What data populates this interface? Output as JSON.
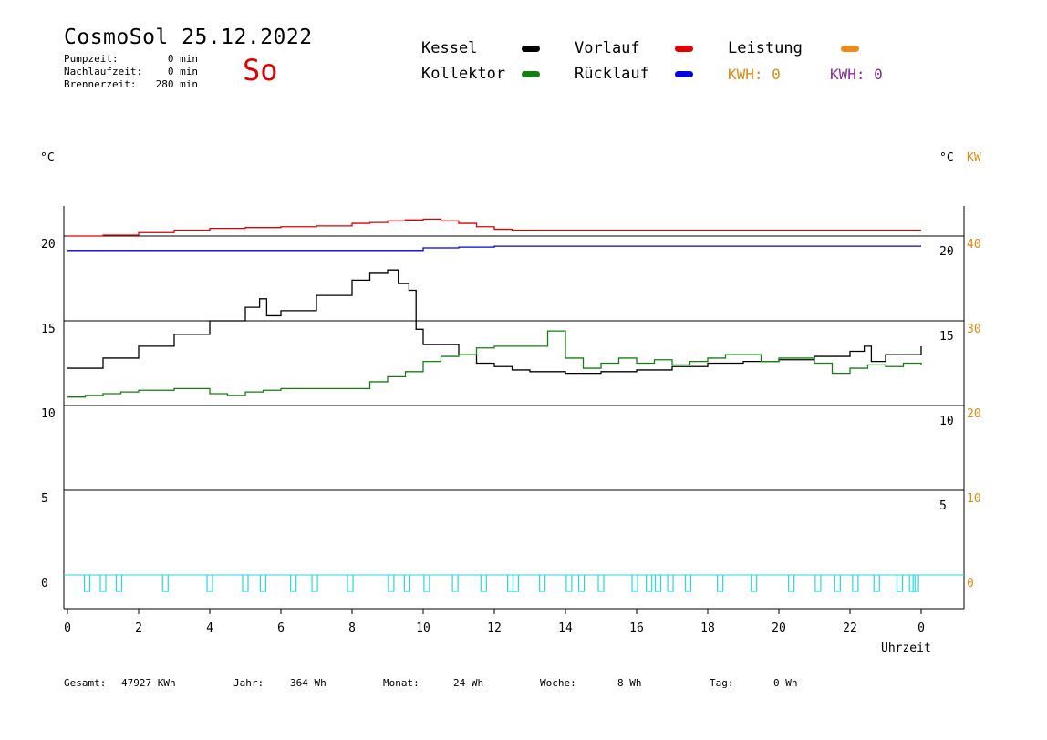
{
  "header": {
    "title": "CosmoSol 25.12.2022",
    "day": "So",
    "stats": [
      {
        "label": "Pumpzeit:",
        "value": "0 min"
      },
      {
        "label": "Nachlaufzeit:",
        "value": "0 min"
      },
      {
        "label": "Brennerzeit:",
        "value": "280 min"
      }
    ]
  },
  "legend": {
    "kessel": "Kessel",
    "vorlauf": "Vorlauf",
    "leistung": "Leistung",
    "kollektor": "Kollektor",
    "ruecklauf": "Rücklauf",
    "kwh_orange": "KWH: 0",
    "kwh_purple": "KWH: 0"
  },
  "units": {
    "left": "°C",
    "right_c": "°C",
    "right_kw": "KW"
  },
  "colors": {
    "kessel": "#000000",
    "vorlauf": "#e00000",
    "leistung": "#f08a1c",
    "kollektor": "#137f13",
    "ruecklauf": "#0000dd",
    "pump": "#26d8df",
    "kw_axis": "#e08a10",
    "purple": "#8b2a9b"
  },
  "footer": {
    "gesamt_label": "Gesamt:",
    "gesamt_value": "47927 KWh",
    "jahr_label": "Jahr:",
    "jahr_value": "364 Wh",
    "monat_label": "Monat:",
    "monat_value": "24 Wh",
    "woche_label": "Woche:",
    "woche_value": "8 Wh",
    "tag_label": "Tag:",
    "tag_value": "0 Wh"
  },
  "chart_data": {
    "type": "line",
    "xlabel": "Uhrzeit",
    "x_ticks": [
      "0",
      "2",
      "4",
      "6",
      "8",
      "10",
      "12",
      "14",
      "16",
      "18",
      "20",
      "22",
      "0"
    ],
    "xlim": [
      0,
      24
    ],
    "y_left": {
      "ylim": [
        -2,
        24
      ],
      "ticks": [
        "0",
        "5",
        "10",
        "15",
        "20"
      ],
      "gridlines": [
        0,
        5,
        10,
        15,
        20
      ]
    },
    "y_right_c": {
      "labels": [
        {
          "text": "10",
          "at": 10
        },
        {
          "text": "15",
          "at": 15
        },
        {
          "text": "20",
          "at": 20
        },
        {
          "text": "5",
          "at": 5
        }
      ]
    },
    "y_right_kw": {
      "labels": [
        {
          "text": "0",
          "at": 0
        },
        {
          "text": "10",
          "at": 5
        },
        {
          "text": "20",
          "at": 10
        },
        {
          "text": "30",
          "at": 15
        },
        {
          "text": "40",
          "at": 20
        }
      ]
    },
    "series": [
      {
        "name": "Vorlauf",
        "color_key": "vorlauf",
        "x": [
          0,
          1,
          2,
          3,
          4,
          5,
          6,
          7,
          8,
          8.5,
          9,
          9.5,
          10,
          10.5,
          11,
          11.5,
          12,
          12.5,
          13,
          14,
          16,
          18,
          20,
          22,
          24
        ],
        "y": [
          20.0,
          20.05,
          20.2,
          20.35,
          20.45,
          20.5,
          20.55,
          20.6,
          20.75,
          20.8,
          20.9,
          20.95,
          21.0,
          20.9,
          20.75,
          20.55,
          20.4,
          20.35,
          20.35,
          20.35,
          20.35,
          20.35,
          20.35,
          20.35,
          20.35
        ]
      },
      {
        "name": "Rücklauf",
        "color_key": "ruecklauf",
        "x": [
          0,
          2,
          4,
          6,
          8,
          10,
          11,
          12,
          13,
          14,
          16,
          18,
          20,
          22,
          24
        ],
        "y": [
          19.15,
          19.15,
          19.15,
          19.15,
          19.15,
          19.3,
          19.35,
          19.4,
          19.4,
          19.4,
          19.4,
          19.4,
          19.4,
          19.4,
          19.4
        ]
      },
      {
        "name": "Kessel",
        "color_key": "kessel",
        "x": [
          0,
          1,
          2,
          3,
          4,
          5,
          5.4,
          5.6,
          6,
          7,
          8,
          8.5,
          9,
          9.3,
          9.6,
          9.8,
          10,
          10.5,
          11,
          11.5,
          12,
          12.5,
          13,
          14,
          15,
          16,
          17,
          18,
          19,
          20,
          21,
          22,
          22.4,
          22.6,
          23,
          24
        ],
        "y": [
          12.2,
          12.8,
          13.5,
          14.2,
          15.0,
          15.8,
          16.3,
          15.3,
          15.6,
          16.5,
          17.4,
          17.8,
          18.0,
          17.2,
          16.8,
          14.5,
          13.6,
          13.6,
          13.0,
          12.5,
          12.3,
          12.1,
          12.0,
          11.9,
          12.0,
          12.1,
          12.3,
          12.5,
          12.6,
          12.7,
          12.9,
          13.2,
          13.5,
          12.6,
          13.0,
          13.5
        ]
      },
      {
        "name": "Kollektor",
        "color_key": "kollektor",
        "x": [
          0,
          0.5,
          1,
          1.5,
          2,
          2.5,
          3,
          3.5,
          4,
          4.5,
          5,
          5.5,
          6,
          6.5,
          7,
          7.5,
          8,
          8.5,
          9,
          9.5,
          10,
          10.5,
          11,
          11.5,
          12,
          12.5,
          13,
          13.5,
          14,
          14.5,
          15,
          15.5,
          16,
          16.5,
          17,
          17.5,
          18,
          18.5,
          19,
          19.5,
          20,
          20.5,
          21,
          21.5,
          22,
          22.5,
          23,
          23.5,
          24
        ],
        "y": [
          10.5,
          10.6,
          10.7,
          10.8,
          10.9,
          10.9,
          11.0,
          11.0,
          10.7,
          10.6,
          10.8,
          10.9,
          11.0,
          11.0,
          11.0,
          11.0,
          11.0,
          11.4,
          11.7,
          12.0,
          12.6,
          12.9,
          13.0,
          13.4,
          13.5,
          13.5,
          13.5,
          14.4,
          12.8,
          12.2,
          12.5,
          12.8,
          12.5,
          12.7,
          12.4,
          12.6,
          12.8,
          13.0,
          13.0,
          12.6,
          12.8,
          12.8,
          12.5,
          11.9,
          12.2,
          12.4,
          12.3,
          12.5,
          12.4
        ]
      }
    ],
    "pump_pulses_hours": [
      0.55,
      1.0,
      1.45,
      2.75,
      4.0,
      5.0,
      5.5,
      6.35,
      6.95,
      7.95,
      9.1,
      9.55,
      10.1,
      10.9,
      11.7,
      12.45,
      12.6,
      13.35,
      14.1,
      14.45,
      15.0,
      15.95,
      16.35,
      16.6,
      16.95,
      17.45,
      18.35,
      19.3,
      20.35,
      21.1,
      21.65,
      22.15,
      22.75,
      23.4,
      23.75,
      23.85
    ]
  }
}
